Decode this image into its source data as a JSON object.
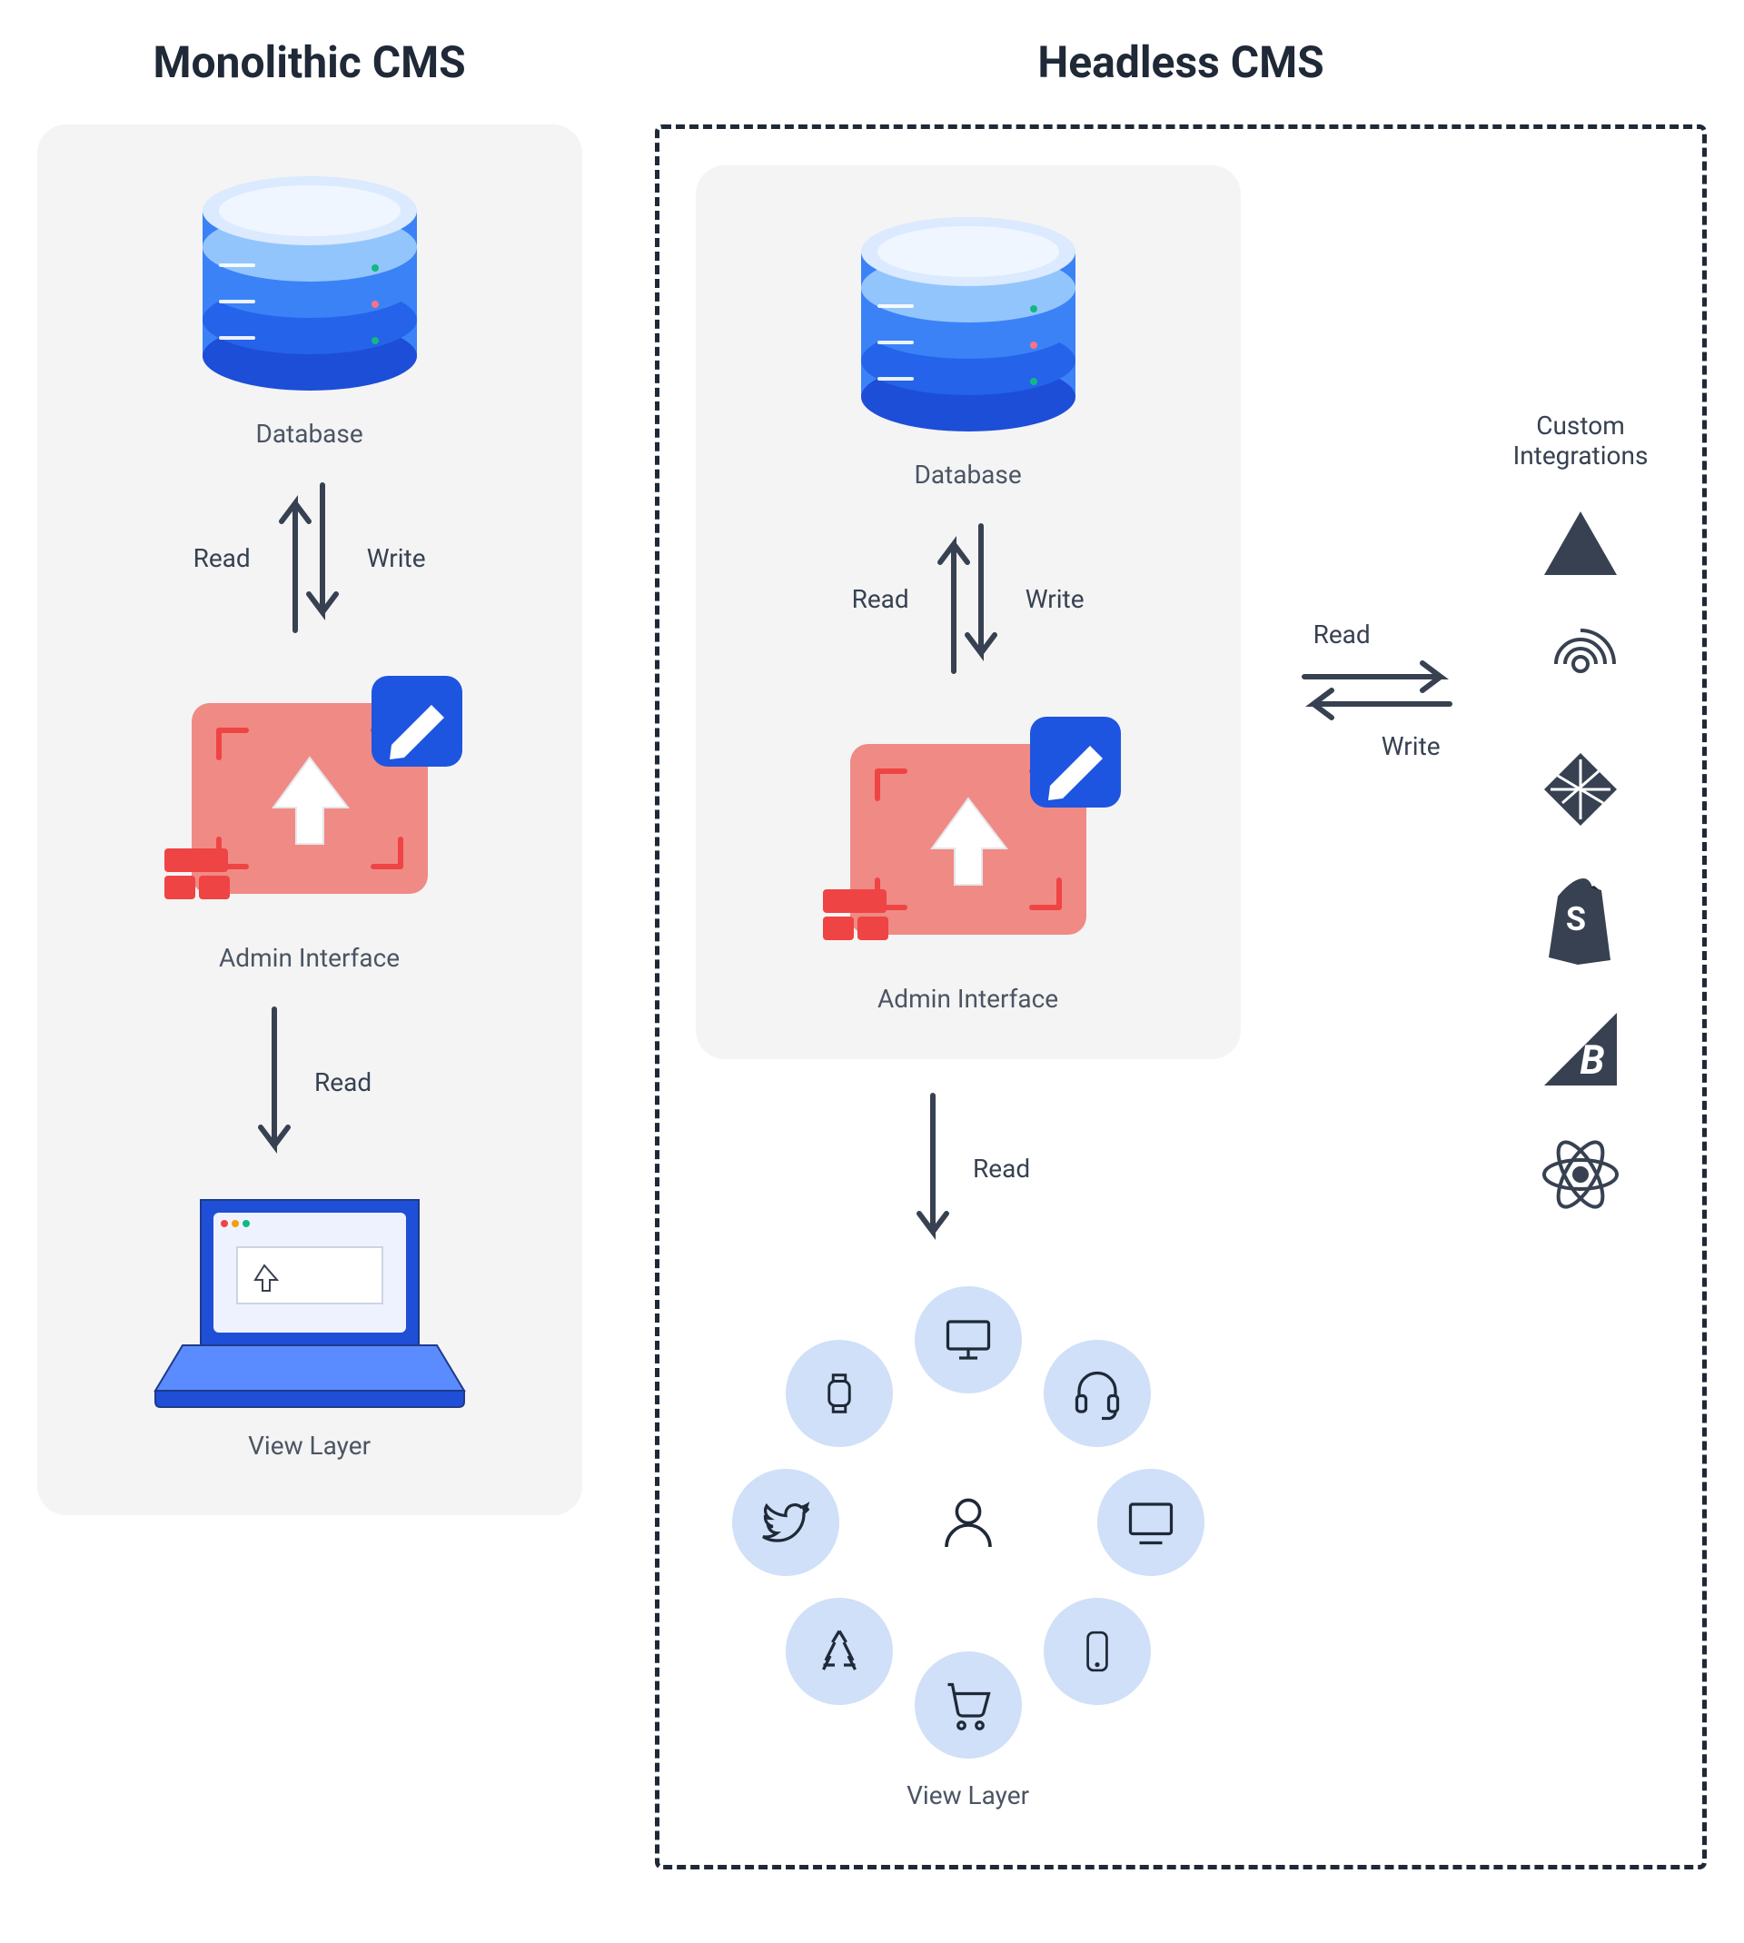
{
  "columns": {
    "monolithic": {
      "title": "Monolithic CMS",
      "database_label": "Database",
      "admin_label": "Admin Interface",
      "view_label": "View Layer",
      "rw": {
        "read": "Read",
        "write": "Write"
      },
      "read_only": "Read"
    },
    "headless": {
      "title": "Headless CMS",
      "database_label": "Database",
      "admin_label": "Admin Interface",
      "view_label": "View Layer",
      "rw": {
        "read": "Read",
        "write": "Write"
      },
      "read_only": "Read",
      "integrations": {
        "title": "Custom Integrations",
        "rw": {
          "read": "Read",
          "write": "Write"
        },
        "items": [
          "vercel",
          "fingerprint",
          "netlify",
          "shopify",
          "bigcommerce",
          "react"
        ]
      },
      "channels": [
        "desktop",
        "headset",
        "monitor",
        "phone",
        "cart",
        "appstore",
        "twitter",
        "watch"
      ]
    }
  }
}
